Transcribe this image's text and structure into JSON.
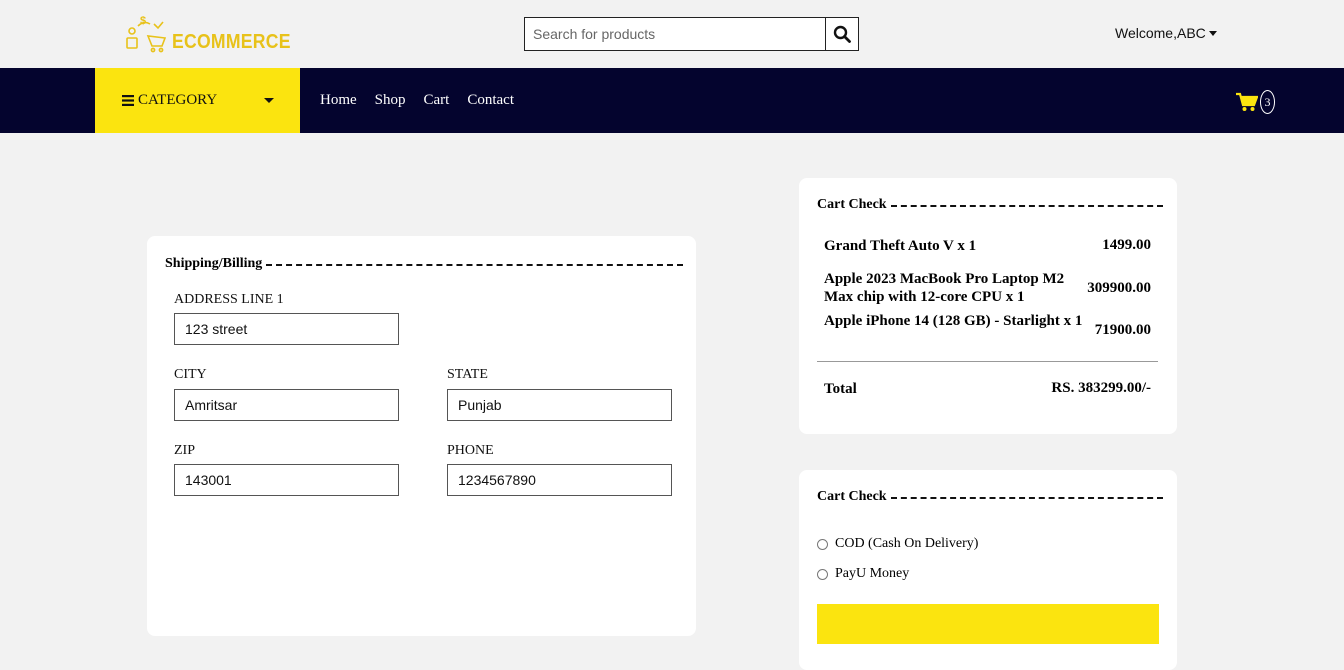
{
  "brand": {
    "name": "ECOMMERCE",
    "color": "#e8c21a"
  },
  "search": {
    "placeholder": "Search for products",
    "icon": "search-icon"
  },
  "user": {
    "welcome": "Welcome,ABC"
  },
  "nav": {
    "category_label": "CATEGORY",
    "links": [
      "Home",
      "Shop",
      "Cart",
      "Contact"
    ],
    "cart_count": "3",
    "accent": "#fbe40f",
    "background": "#04042e"
  },
  "shipping": {
    "title": "Shipping/Billing",
    "fields": {
      "address": {
        "label": "ADDRESS LINE 1",
        "value": "123 street"
      },
      "city": {
        "label": "CITY",
        "value": "Amritsar"
      },
      "state": {
        "label": "STATE",
        "value": "Punjab"
      },
      "zip": {
        "label": "ZIP",
        "value": "143001"
      },
      "phone": {
        "label": "PHONE",
        "value": "1234567890"
      }
    }
  },
  "cart_check": {
    "title": "Cart Check",
    "items": [
      {
        "name": "Grand Theft Auto V x 1",
        "price": "1499.00"
      },
      {
        "name": "Apple 2023 MacBook Pro Laptop M2 Max chip with 12-core CPU x 1",
        "price": "309900.00"
      },
      {
        "name": "Apple iPhone 14 (128 GB) - Starlight x 1",
        "price": "71900.00"
      }
    ],
    "total_label": "Total",
    "total_value": "RS. 383299.00/-"
  },
  "payment": {
    "title": "Cart Check",
    "options": [
      "COD (Cash On Delivery)",
      "PayU Money"
    ]
  }
}
